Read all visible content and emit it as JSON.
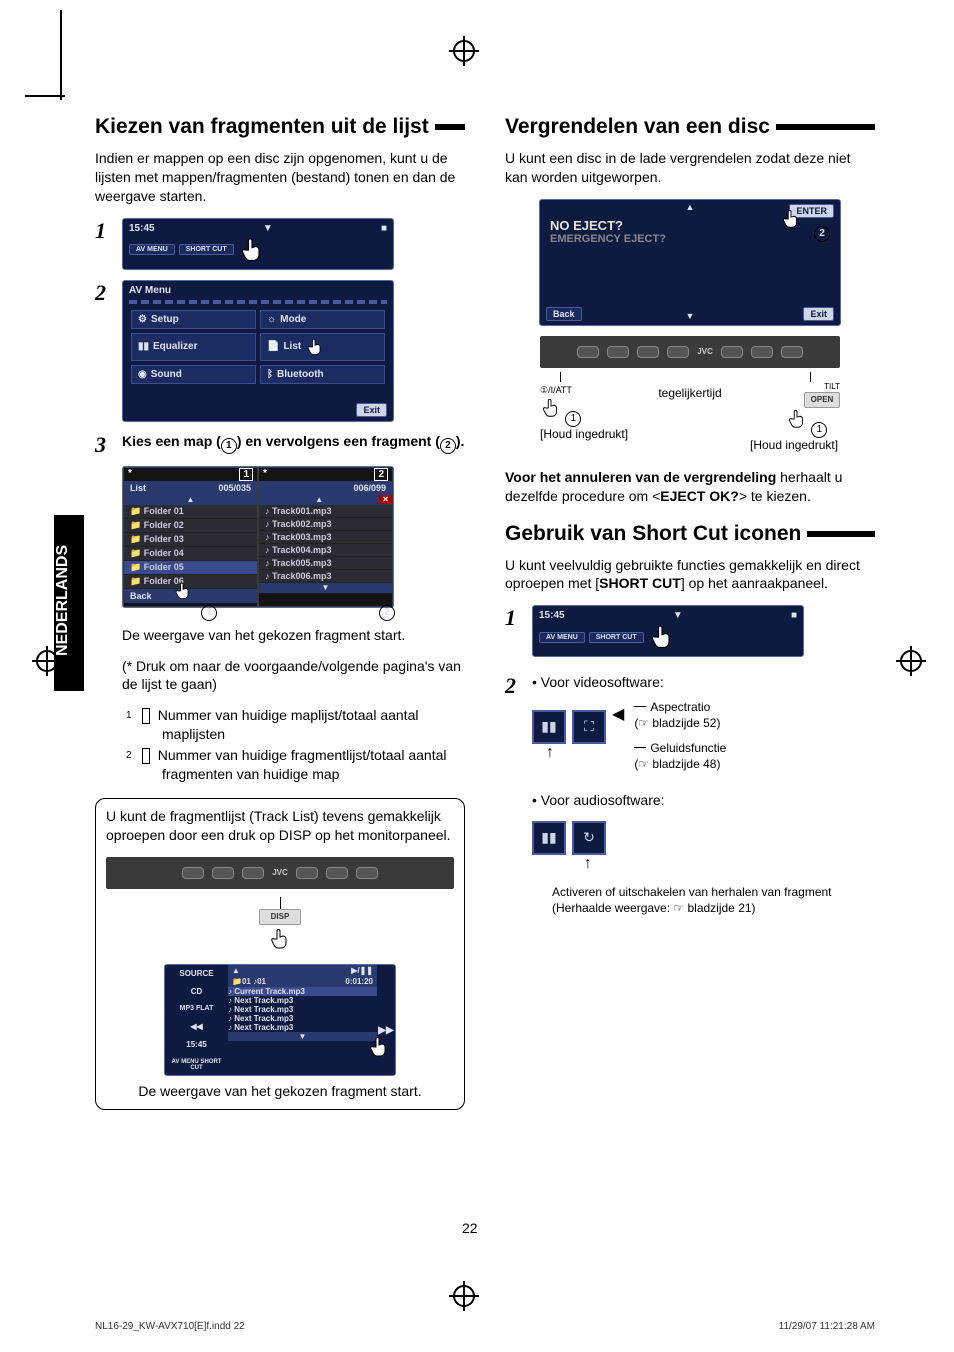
{
  "sidebar_tab": "NEDERLANDS",
  "page_number": "22",
  "footer_left": "NL16-29_KW-AVX710[E]f.indd   22",
  "footer_right": "11/29/07   11:21:28 AM",
  "left": {
    "h1": "Kiezen van fragmenten uit de lijst",
    "intro": "Indien er mappen op een disc zijn opgenomen, kunt u de lijsten met mappen/fragmenten (bestand) tonen en dan de weergave starten.",
    "step1": {
      "num": "1",
      "time": "15:45",
      "btn1": "AV MENU",
      "btn2": "SHORT CUT"
    },
    "step2": {
      "num": "2",
      "title": "AV Menu",
      "items": [
        "Setup",
        "Equalizer",
        "Sound"
      ],
      "items_r": [
        "Mode",
        "List",
        "Bluetooth"
      ],
      "exit": "Exit"
    },
    "step3": {
      "num": "3",
      "text_a": "Kies een map (",
      "text_b": ") en vervolgens een fragment (",
      "text_c": ").",
      "list_label": "List",
      "count1": "005/035",
      "count2": "006/099",
      "folders": [
        "Folder 01",
        "Folder 02",
        "Folder 03",
        "Folder 04",
        "Folder 05",
        "Folder 06"
      ],
      "tracks": [
        "Track001.mp3",
        "Track002.mp3",
        "Track003.mp3",
        "Track004.mp3",
        "Track005.mp3",
        "Track006.mp3"
      ],
      "back": "Back",
      "caption": "De weergave van het gekozen fragment start.",
      "note": "(* Druk om naar de voorgaande/volgende pagina's van de lijst te gaan)",
      "annot1": "Nummer van huidige maplijst/totaal aantal maplijsten",
      "annot2": "Nummer van huidige fragmentlijst/totaal aantal fragmenten van huidige map"
    },
    "box": {
      "text": "U kunt de fragmentlijst (Track List) tevens gemakkelijk oproepen door een druk op DISP op het monitorpaneel.",
      "dev_label": "JVC",
      "disp": "DISP",
      "source": "SOURCE",
      "cd": "CD",
      "mp3": "MP3 FLAT",
      "foldernum": "01",
      "tracknum": "01",
      "tracktime": "0:01:20",
      "cur": "Current Track.mp3",
      "next": "Next Track.mp3",
      "time": "15:45",
      "caption": "De weergave van het gekozen fragment start."
    }
  },
  "right": {
    "h1a": "Vergrendelen van een disc",
    "intro_a": "U kunt een disc in de lade vergrendelen zodat deze niet kan worden uitgeworpen.",
    "eject": {
      "line1": "NO EJECT?",
      "line2": "EMERGENCY EJECT?",
      "back": "Back",
      "exit": "Exit",
      "enter": "ENTER",
      "dev": "JVC",
      "hold_l": "[Houd ingedrukt]",
      "mid": "tegelijkertijd",
      "hold_r": "[Houd ingedrukt]",
      "tilt": "TILT",
      "open": "OPEN",
      "att": "①/I/ATT"
    },
    "cancel_a": "Voor het annuleren van de vergrendeling",
    "cancel_b": " herhaalt u dezelfde procedure om <",
    "cancel_c": "EJECT OK?",
    "cancel_d": "> te kiezen.",
    "h1b": "Gebruik van Short Cut iconen",
    "intro_b_a": "U kunt veelvuldig gebruikte functies gemakkelijk en direct oproepen met [",
    "intro_b_b": "SHORT CUT",
    "intro_b_c": "] op het aanraakpaneel.",
    "step1": {
      "num": "1",
      "time": "15:45",
      "btn1": "AV MENU",
      "btn2": "SHORT CUT"
    },
    "step2": {
      "num": "2",
      "video_label": "•  Voor videosoftware:",
      "aspect": "Aspectratio",
      "aspect_ref": "(☞ bladzijde 52)",
      "sound": "Geluidsfunctie",
      "sound_ref": "(☞ bladzijde 48)",
      "audio_label": "•  Voor audiosoftware:",
      "repeat": "Activeren of uitschakelen van herhalen van fragment",
      "repeat_ref": "(Herhaalde weergave: ☞ bladzijde 21)"
    }
  }
}
